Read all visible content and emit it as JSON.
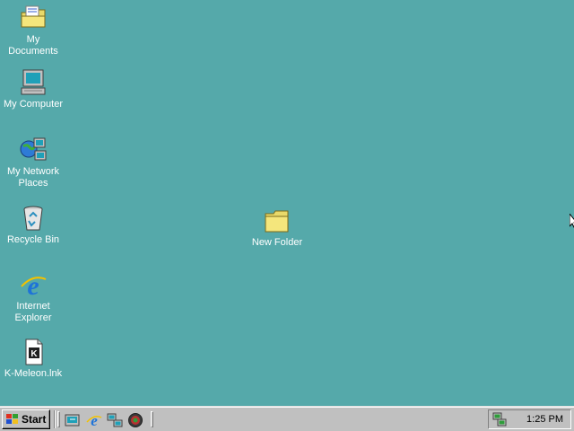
{
  "desktop": {
    "background": "#55a9aa",
    "icons": [
      {
        "label": "My Documents",
        "icon": "my-documents-icon"
      },
      {
        "label": "My Computer",
        "icon": "my-computer-icon"
      },
      {
        "label": "My Network Places",
        "icon": "network-places-icon"
      },
      {
        "label": "Recycle Bin",
        "icon": "recycle-bin-icon"
      },
      {
        "label": "Internet Explorer",
        "icon": "internet-explorer-icon"
      },
      {
        "label": "K-Meleon.lnk",
        "icon": "k-meleon-shortcut-icon"
      },
      {
        "label": "New Folder",
        "icon": "folder-icon"
      }
    ]
  },
  "taskbar": {
    "start_label": "Start",
    "quick_launch": [
      "show-desktop-icon",
      "internet-explorer-icon",
      "network-icon",
      "globe-icon"
    ],
    "tray": {
      "icon": "network-status-icon",
      "clock": "1:25 PM"
    }
  }
}
